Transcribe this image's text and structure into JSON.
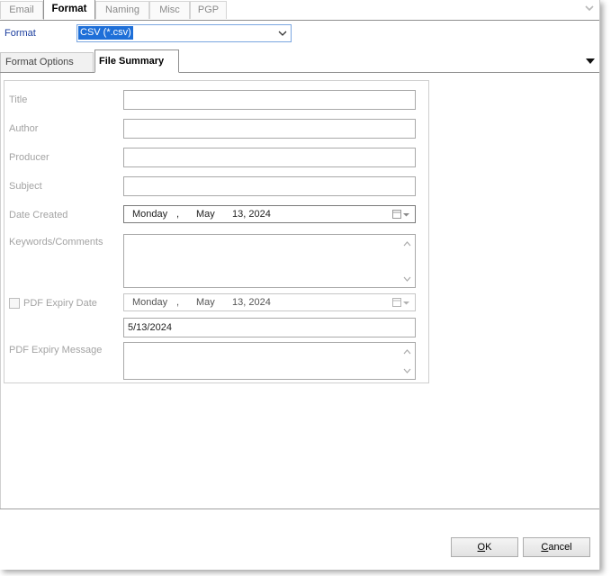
{
  "top_tabs": [
    {
      "label": "Email",
      "active": false
    },
    {
      "label": "Format",
      "active": true
    },
    {
      "label": "Naming",
      "active": false
    },
    {
      "label": "Misc",
      "active": false
    },
    {
      "label": "PGP",
      "active": false
    }
  ],
  "format": {
    "label": "Format",
    "selected": "CSV (*.csv)"
  },
  "sub_tabs": [
    {
      "label": "Format Options",
      "active": false
    },
    {
      "label": "File Summary",
      "active": true
    }
  ],
  "file_summary": {
    "title_label": "Title",
    "title_value": "",
    "author_label": "Author",
    "author_value": "",
    "producer_label": "Producer",
    "producer_value": "",
    "subject_label": "Subject",
    "subject_value": "",
    "date_created_label": "Date Created",
    "date_created": {
      "weekday": "Monday",
      "sep": ",",
      "month": "May",
      "day_year": "13, 2024"
    },
    "keywords_label": "Keywords/Comments",
    "keywords_value": "",
    "pdf_expiry_label": "PDF Expiry Date",
    "pdf_expiry_checked": false,
    "pdf_expiry_date": {
      "weekday": "Monday",
      "sep": ",",
      "month": "May",
      "day_year": "13, 2024"
    },
    "pdf_expiry_text": "5/13/2024",
    "pdf_expiry_message_label": "PDF Expiry Message",
    "pdf_expiry_message_value": ""
  },
  "buttons": {
    "ok_key": "O",
    "ok_rest": "K",
    "cancel_key": "C",
    "cancel_rest": "ancel"
  },
  "colors": {
    "accent": "#1e6fd8",
    "label_blue": "#1a3d9e",
    "disabled_text": "#a3a3a3"
  },
  "icons": [
    "chevron-down-icon",
    "dropdown-arrow-icon",
    "calendar-icon",
    "scroll-up-icon",
    "scroll-down-icon"
  ]
}
